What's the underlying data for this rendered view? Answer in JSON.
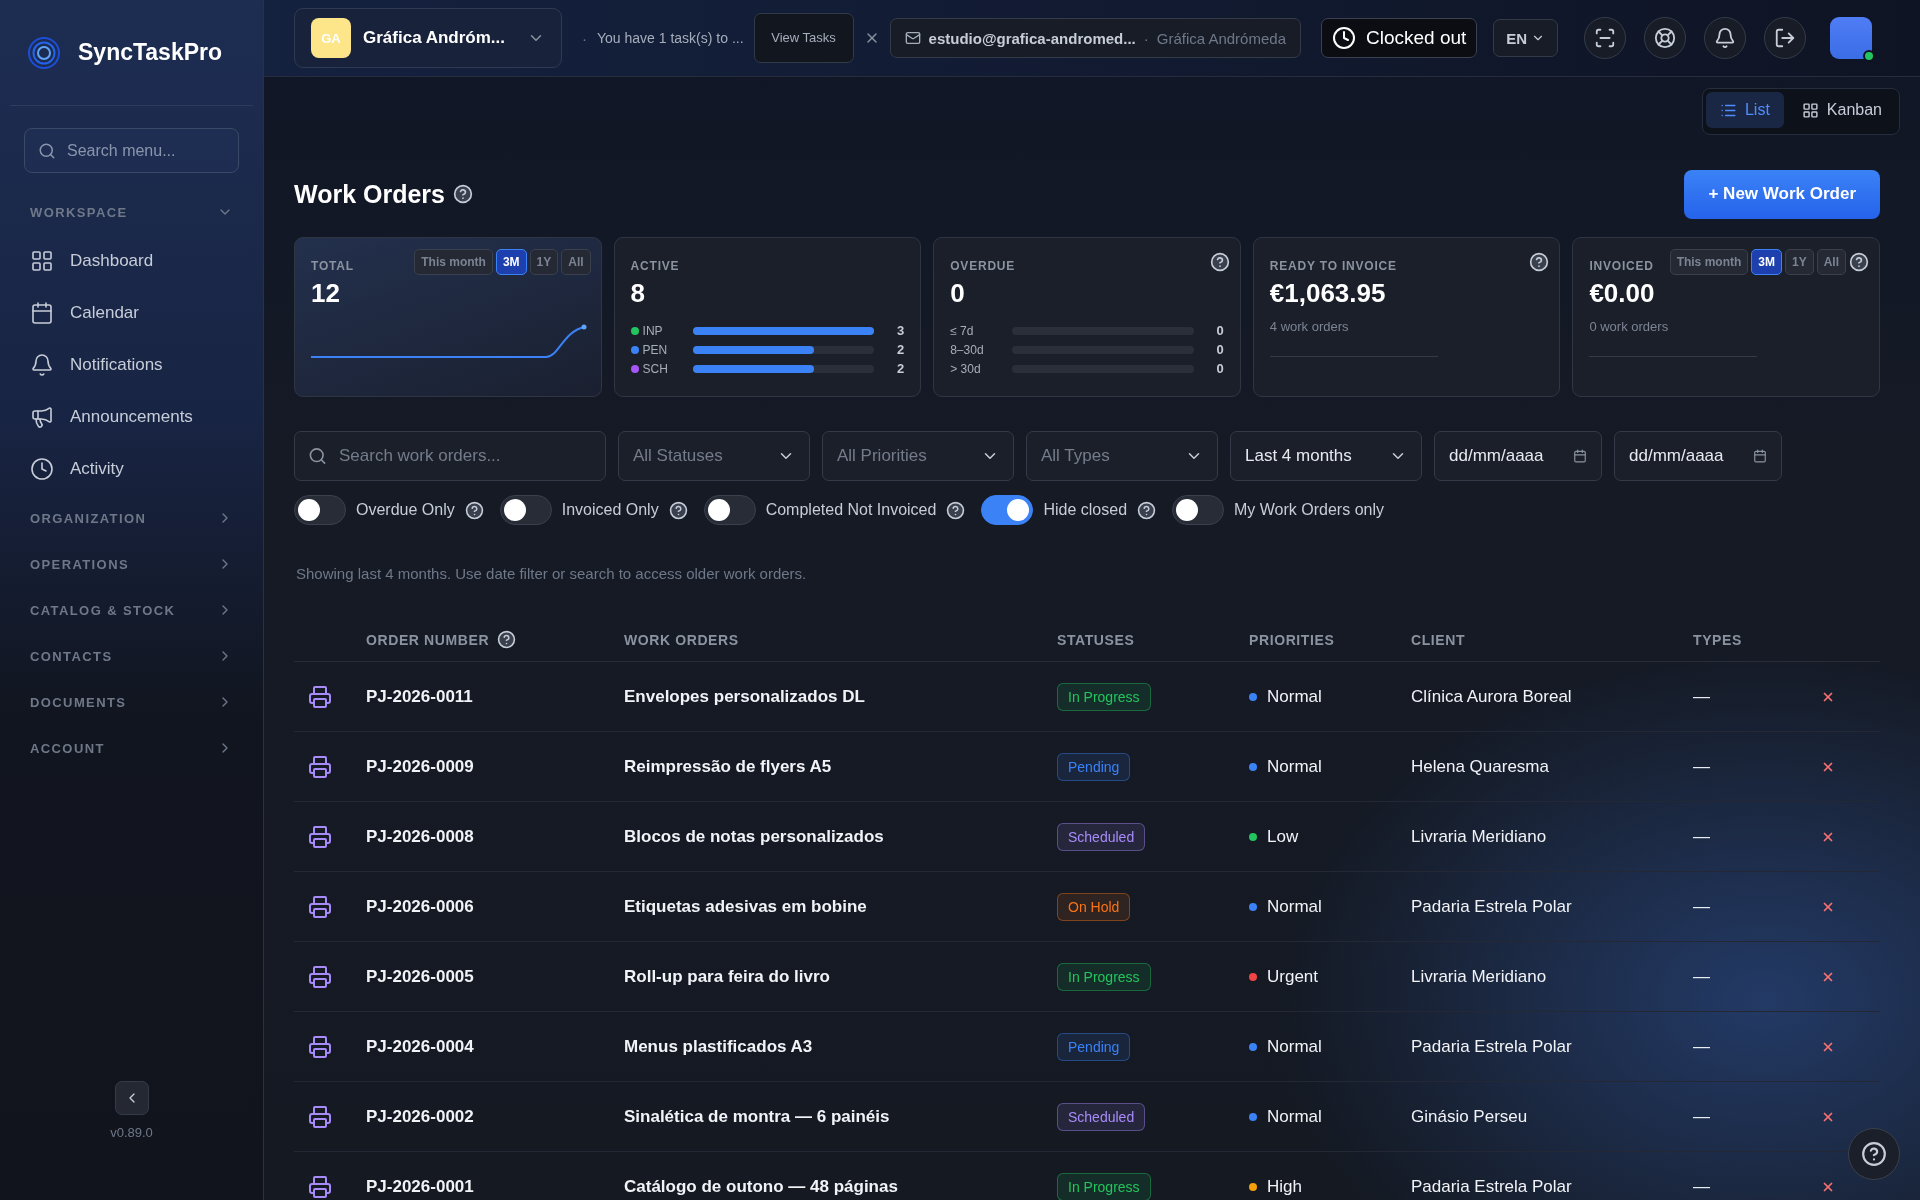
{
  "sidebar": {
    "logo": "SyncTaskPro",
    "search": {
      "placeholder": "Search menu..."
    },
    "sections": [
      {
        "title": "WORKSPACE",
        "expanded": true,
        "items": [
          {
            "label": "Dashboard"
          },
          {
            "label": "Calendar"
          },
          {
            "label": "Notifications"
          },
          {
            "label": "Announcements"
          },
          {
            "label": "Activity"
          }
        ]
      },
      {
        "title": "ORGANIZATION",
        "expanded": false
      },
      {
        "title": "OPERATIONS",
        "expanded": false
      },
      {
        "title": "CATALOG & STOCK",
        "expanded": false
      },
      {
        "title": "CONTACTS",
        "expanded": false
      },
      {
        "title": "DOCUMENTS",
        "expanded": false
      },
      {
        "title": "ACCOUNT",
        "expanded": false
      }
    ],
    "version": "v0.89.0"
  },
  "topbar": {
    "company": {
      "initials": "GA",
      "name": "Gráfica Andróm..."
    },
    "task_notice": {
      "separator": "·",
      "text": "You have 1 task(s) to ...",
      "button": "View Tasks"
    },
    "account": {
      "email": "estudio@grafica-andromed...",
      "separator": "·",
      "company": "Gráfica Andrómeda"
    },
    "clock": {
      "label": "Clocked out"
    },
    "language": "EN",
    "user": {
      "online": true
    }
  },
  "views": [
    {
      "label": "List",
      "selected": true
    },
    {
      "label": "Kanban",
      "selected": false
    }
  ],
  "page": {
    "title": "Work Orders",
    "new_button": "+ New Work Order"
  },
  "stats": [
    {
      "kind": "trend",
      "label": "TOTAL",
      "value": "12",
      "help": false,
      "ranges": [
        {
          "label": "This month",
          "selected": false
        },
        {
          "label": "3M",
          "selected": true
        },
        {
          "label": "1Y",
          "selected": false
        },
        {
          "label": "All",
          "selected": false
        }
      ]
    },
    {
      "kind": "breakdown",
      "label": "ACTIVE",
      "value": "8",
      "help": false,
      "rows": [
        {
          "label": "INP",
          "color": "#22c55e",
          "level": 1,
          "count": "3"
        },
        {
          "label": "PEN",
          "color": "#3b82f6",
          "level": 0.67,
          "count": "2"
        },
        {
          "label": "SCH",
          "color": "#a855f7",
          "level": 0.67,
          "count": "2"
        }
      ]
    },
    {
      "kind": "aging",
      "label": "OVERDUE",
      "value": "0",
      "help": true,
      "rows": [
        {
          "label": "≤ 7d",
          "count": "0"
        },
        {
          "label": "8–30d",
          "count": "0"
        },
        {
          "label": "> 30d",
          "count": "0"
        }
      ]
    },
    {
      "kind": "amount",
      "label": "READY TO INVOICE",
      "value": "€1,063.95",
      "note": "4 work orders",
      "help": true
    },
    {
      "kind": "amount",
      "label": "INVOICED",
      "value": "€0.00",
      "note": "0 work orders",
      "help": true,
      "ranges": [
        {
          "label": "This month",
          "selected": false
        },
        {
          "label": "3M",
          "selected": true
        },
        {
          "label": "1Y",
          "selected": false
        },
        {
          "label": "All",
          "selected": false
        }
      ]
    }
  ],
  "filters": {
    "search": {
      "placeholder": "Search work orders..."
    },
    "selects": [
      {
        "text": "All Statuses",
        "default": true
      },
      {
        "text": "All Priorities",
        "default": true
      },
      {
        "text": "All Types",
        "default": true
      },
      {
        "text": "Last 4 months",
        "default": false
      }
    ],
    "dates": [
      {
        "text": "dd/mm/aaaa"
      },
      {
        "text": "dd/mm/aaaa"
      }
    ],
    "toggles": [
      {
        "label": "Overdue Only",
        "on": false,
        "help": true
      },
      {
        "label": "Invoiced Only",
        "on": false,
        "help": true
      },
      {
        "label": "Completed Not Invoiced",
        "on": false,
        "help": true
      },
      {
        "label": "Hide closed",
        "on": true,
        "help": true
      },
      {
        "label": "My Work Orders only",
        "on": false
      }
    ],
    "note": "Showing last 4 months. Use date filter or search to access older work orders."
  },
  "table": {
    "columns": [
      {
        "label": "ORDER NUMBER",
        "help": true
      },
      {
        "label": "WORK ORDERS"
      },
      {
        "label": "STATUSES"
      },
      {
        "label": "PRIORITIES"
      },
      {
        "label": "CLIENT"
      },
      {
        "label": "TYPES"
      }
    ],
    "rows": [
      {
        "number": "PJ-2026-0011",
        "title": "Envelopes personalizados DL",
        "status": {
          "label": "In Progress",
          "kind": "in_progress"
        },
        "priority": {
          "label": "Normal",
          "color": "#3b82f6"
        },
        "client": "Clínica Aurora Boreal",
        "type": "—"
      },
      {
        "number": "PJ-2026-0009",
        "title": "Reimpressão de flyers A5",
        "status": {
          "label": "Pending",
          "kind": "pending"
        },
        "priority": {
          "label": "Normal",
          "color": "#3b82f6"
        },
        "client": "Helena Quaresma",
        "type": "—"
      },
      {
        "number": "PJ-2026-0008",
        "title": "Blocos de notas personalizados",
        "status": {
          "label": "Scheduled",
          "kind": "scheduled"
        },
        "priority": {
          "label": "Low",
          "color": "#22c55e"
        },
        "client": "Livraria Meridiano",
        "type": "—"
      },
      {
        "number": "PJ-2026-0006",
        "title": "Etiquetas adesivas em bobine",
        "status": {
          "label": "On Hold",
          "kind": "on_hold"
        },
        "priority": {
          "label": "Normal",
          "color": "#3b82f6"
        },
        "client": "Padaria Estrela Polar",
        "type": "—"
      },
      {
        "number": "PJ-2026-0005",
        "title": "Roll-up para feira do livro",
        "status": {
          "label": "In Progress",
          "kind": "in_progress"
        },
        "priority": {
          "label": "Urgent",
          "color": "#ef4444"
        },
        "client": "Livraria Meridiano",
        "type": "—"
      },
      {
        "number": "PJ-2026-0004",
        "title": "Menus plastificados A3",
        "status": {
          "label": "Pending",
          "kind": "pending"
        },
        "priority": {
          "label": "Normal",
          "color": "#3b82f6"
        },
        "client": "Padaria Estrela Polar",
        "type": "—"
      },
      {
        "number": "PJ-2026-0002",
        "title": "Sinalética de montra — 6 painéis",
        "status": {
          "label": "Scheduled",
          "kind": "scheduled"
        },
        "priority": {
          "label": "Normal",
          "color": "#3b82f6"
        },
        "client": "Ginásio Perseu",
        "type": "—"
      },
      {
        "number": "PJ-2026-0001",
        "title": "Catálogo de outono — 48 páginas",
        "status": {
          "label": "In Progress",
          "kind": "in_progress"
        },
        "priority": {
          "label": "High",
          "color": "#f59e0b"
        },
        "client": "Padaria Estrela Polar",
        "type": "—"
      }
    ]
  }
}
